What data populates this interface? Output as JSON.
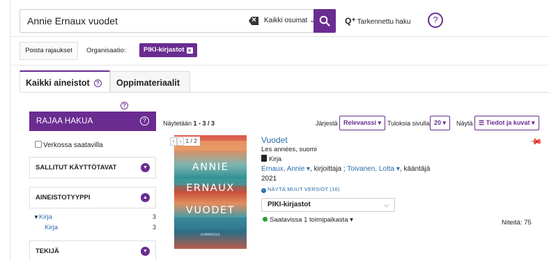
{
  "search": {
    "query": "Annie Ernaux vuodet",
    "scope": "Kaikki osumat",
    "advanced_label": "Tarkennettu haku",
    "help": "?"
  },
  "filters": {
    "remove_label": "Poista rajaukset",
    "org_label": "Organisaatio:",
    "org_chip": "PIKI-kirjastot"
  },
  "tabs": [
    {
      "label": "Kaikki aineistot",
      "active": true
    },
    {
      "label": "Oppimateriaalit",
      "active": false
    }
  ],
  "sidebar": {
    "header": "RAJAA HAKUA",
    "online_label": "Verkossa saatavilla",
    "facets": [
      {
        "label": "SALLITUT KÄYTTÖTAVAT",
        "expanded": false
      },
      {
        "label": "AINEISTOTYYPPI",
        "expanded": true,
        "items": [
          {
            "label": "Kirja",
            "count": "3"
          },
          {
            "label": "Kirja",
            "count": "3"
          }
        ]
      },
      {
        "label": "TEKIJÄ",
        "expanded": false
      }
    ]
  },
  "results": {
    "showing_prefix": "Näytetään",
    "showing_range": "1 - 3 / 3",
    "sort_label": "Järjestä",
    "sort_value": "Relevanssi",
    "per_page_label": "Tuloksia sivulla",
    "per_page_value": "20",
    "view_label": "Näytä",
    "view_value": "Tiedot ja kuvat"
  },
  "record": {
    "cover_nav": "1 / 2",
    "cover_lines": [
      "ANNIE",
      "ERNAUX",
      "VUODET"
    ],
    "cover_publisher": "GUMMERUS",
    "title": "Vuodet",
    "subtitle": "Les années, suomi",
    "format": "Kirja",
    "author1": "Ernaux, Annie",
    "role1": ", kirjoittaja ;",
    "author2": "Toivanen, Lotta",
    "role2": ", kääntäjä",
    "year": "2021",
    "versions": "NÄYTÄ MUUT VERSIOT (16)",
    "library": "PIKI-kirjastot",
    "availability": "Saatavissa 1 toimipaikasta",
    "copies": "Niteitä: 75"
  },
  "colors": {
    "brand": "#6a2c91",
    "link": "#2a6ca8",
    "available": "#2e9a3a"
  }
}
